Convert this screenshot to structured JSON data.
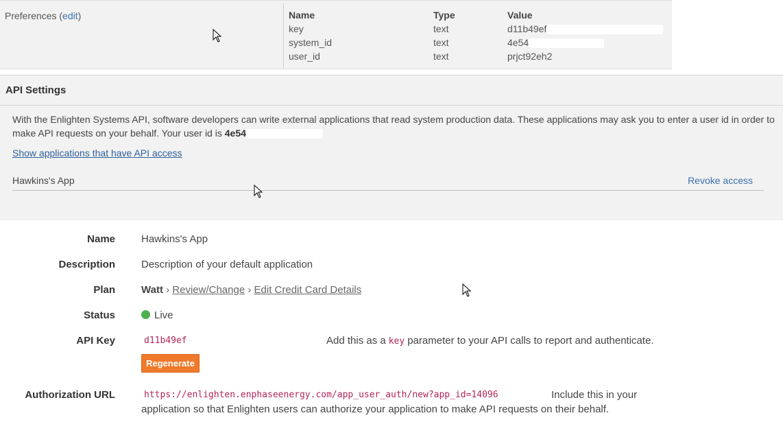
{
  "preferences": {
    "label": "Preferences",
    "edit_label": "edit",
    "table": {
      "headers": [
        "Name",
        "Type",
        "Value"
      ],
      "rows": [
        {
          "name": "key",
          "type": "text",
          "value": "d11b49ef"
        },
        {
          "name": "system_id",
          "type": "text",
          "value": "4e54"
        },
        {
          "name": "user_id",
          "type": "text",
          "value": "prjct92eh2"
        }
      ]
    }
  },
  "api_settings": {
    "title": "API Settings",
    "description": "With the Enlighten Systems API, software developers can write external applications that read system production data. These applications may ask you to enter a user id in order to make API requests on your behalf. Your user id is",
    "user_id": "4e54",
    "show_apps_link": "Show applications that have API access",
    "app_name": "Hawkins's App",
    "revoke_label": "Revoke access"
  },
  "details": {
    "name_label": "Name",
    "name_value": "Hawkins's App",
    "description_label": "Description",
    "description_value": "Description of your default application",
    "plan_label": "Plan",
    "plan_value": "Watt",
    "plan_review_link": "Review/Change",
    "plan_card_link": "Edit Credit Card Details",
    "status_label": "Status",
    "status_value": "Live",
    "api_key_label": "API Key",
    "api_key_value": "d11b49ef",
    "api_key_help_pre": "Add this as a",
    "api_key_help_code": "key",
    "api_key_help_post": "parameter to your API calls to report and authenticate.",
    "regenerate_label": "Regenerate",
    "auth_url_label": "Authorization URL",
    "auth_url_value": "https://enlighten.enphaseenergy.com/app_user_auth/new?app_id=14096",
    "auth_help_line1": "Include this in your",
    "auth_help_line2": "application so that Enlighten users can authorize your application to make API requests on their behalf."
  },
  "colors": {
    "status_live": "#4caf50",
    "regenerate_bg": "#ef7a2b",
    "link": "#3a6fb0"
  }
}
